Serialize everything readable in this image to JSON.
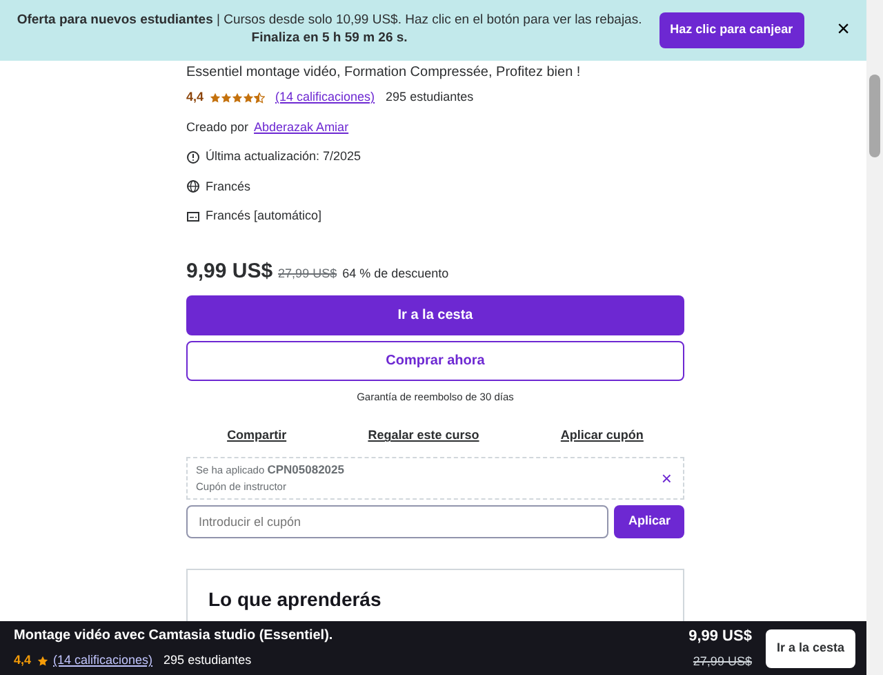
{
  "banner": {
    "lead": "Oferta para nuevos estudiantes",
    "text": " | Cursos desde solo 10,99 US$. Haz clic en el botón para ver las rebajas.",
    "countdown": "Finaliza en 5 h 59 m 26 s.",
    "button": "Haz clic para canjear",
    "close": "×"
  },
  "course": {
    "subtitle": "Essentiel montage vidéo, Formation Compressée, Profitez bien !",
    "rating": "4,4",
    "stars": 4.5,
    "ratings_link": "(14 calificaciones)",
    "students": "295 estudiantes",
    "created_by": "Creado por",
    "author": "Abderazak Amiar",
    "meta": [
      {
        "kind": "updated",
        "text": "Última actualización: 7/2025"
      },
      {
        "kind": "language",
        "text": "Francés"
      },
      {
        "kind": "captions",
        "text": "Francés [automático]"
      }
    ]
  },
  "purchase": {
    "price": "9,99 US$",
    "old_price": "27,99 US$",
    "discount": "64 % de descuento",
    "cart_button": "Ir a la cesta",
    "buy_button": "Comprar ahora",
    "guarantee": "Garantía de reembolso de 30 días",
    "links": [
      "Compartir",
      "Regalar este curso",
      "Aplicar cupón"
    ],
    "coupon": {
      "applied_label": "Se ha aplicado",
      "code": "CPN05082025",
      "type": "Cupón de instructor",
      "remove": "×"
    },
    "coupon_field": {
      "placeholder": "Introducir el cupón"
    },
    "apply_button": "Aplicar"
  },
  "learn": {
    "title": "Lo que aprenderás"
  },
  "bottom_bar": {
    "title": "Montage vidéo avec Camtasia studio (Essentiel).",
    "rating": "4,4",
    "ratings_link": "(14 calificaciones)",
    "students": "295 estudiantes",
    "price": "9,99 US$",
    "old_price": "27,99 US$",
    "cart_button": "Ir a la cesta"
  }
}
